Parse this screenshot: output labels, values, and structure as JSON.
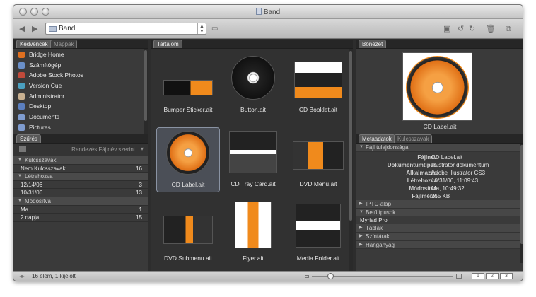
{
  "window": {
    "title": "Band"
  },
  "toolbar": {
    "path": "Band"
  },
  "favorites_panel": {
    "tabs": [
      "Kedvencek",
      "Mappák"
    ],
    "items": [
      {
        "label": "Bridge Home",
        "icon": "bridge-icon",
        "color": "#e07020"
      },
      {
        "label": "Számítógép",
        "icon": "computer-icon",
        "color": "#6a8fc8"
      },
      {
        "label": "Adobe Stock Photos",
        "icon": "stock-photos-icon",
        "color": "#c04a3a"
      },
      {
        "label": "Version Cue",
        "icon": "version-cue-icon",
        "color": "#4aa0c0"
      },
      {
        "label": "Administrator",
        "icon": "home-icon",
        "color": "#c8b090"
      },
      {
        "label": "Desktop",
        "icon": "desktop-icon",
        "color": "#5b7fc0"
      },
      {
        "label": "Documents",
        "icon": "documents-folder-icon",
        "color": "#7f9ccf"
      },
      {
        "label": "Pictures",
        "icon": "pictures-folder-icon",
        "color": "#7f9ccf"
      }
    ]
  },
  "filter_panel": {
    "tab": "Szűrés",
    "sort_label": "Rendezés Fájlnév szerint",
    "groups": [
      {
        "title": "Kulcsszavak",
        "rows": [
          {
            "label": "Nem Kulcsszavak",
            "count": "16"
          }
        ]
      },
      {
        "title": "Létrehozva",
        "rows": [
          {
            "label": "12/14/06",
            "count": "3"
          },
          {
            "label": "10/31/06",
            "count": "13"
          }
        ]
      },
      {
        "title": "Módosítva",
        "rows": [
          {
            "label": "Ma",
            "count": "1"
          },
          {
            "label": "2 napja",
            "count": "15"
          }
        ]
      }
    ]
  },
  "content_panel": {
    "tab": "Tartalom",
    "items": [
      {
        "label": "Bumper Sticker.ait"
      },
      {
        "label": "Button.ait"
      },
      {
        "label": "CD Booklet.ait"
      },
      {
        "label": "CD Label.ait",
        "selected": true
      },
      {
        "label": "CD Tray Card.ait"
      },
      {
        "label": "DVD Menu.ait"
      },
      {
        "label": "DVD Submenu.ait"
      },
      {
        "label": "Flyer.ait"
      },
      {
        "label": "Media Folder.ait"
      }
    ]
  },
  "preview_panel": {
    "tab": "Bőnézet",
    "caption": "CD Label.ait"
  },
  "metadata_panel": {
    "tabs": [
      "Metaadatok",
      "Kulcsszavak"
    ],
    "file_section": "Fájl tulajdonságai",
    "properties": [
      {
        "key": "Fájlnév",
        "value": "CD Label.ait"
      },
      {
        "key": "Dokumentumtípus",
        "value": "Illustrator dokumentum"
      },
      {
        "key": "Alkalmazás",
        "value": "Adobe Illustrator CS3"
      },
      {
        "key": "Létrehozva",
        "value": "10/31/06, 11:09:43"
      },
      {
        "key": "Módosítva",
        "value": "Ma, 10:49:32"
      },
      {
        "key": "Fájlméret",
        "value": "255 KB"
      }
    ],
    "sections_a": [
      "IPTC-alap",
      "Betűtípusok"
    ],
    "font_value": "Myriad Pro",
    "sections_b": [
      "Táblák",
      "Színtárak",
      "Hanganyag"
    ]
  },
  "status": {
    "text": "16 elem, 1 kijelölt"
  },
  "colors": {
    "accent_orange": "#f08a1c",
    "panel_bg": "#3a3a3a"
  }
}
